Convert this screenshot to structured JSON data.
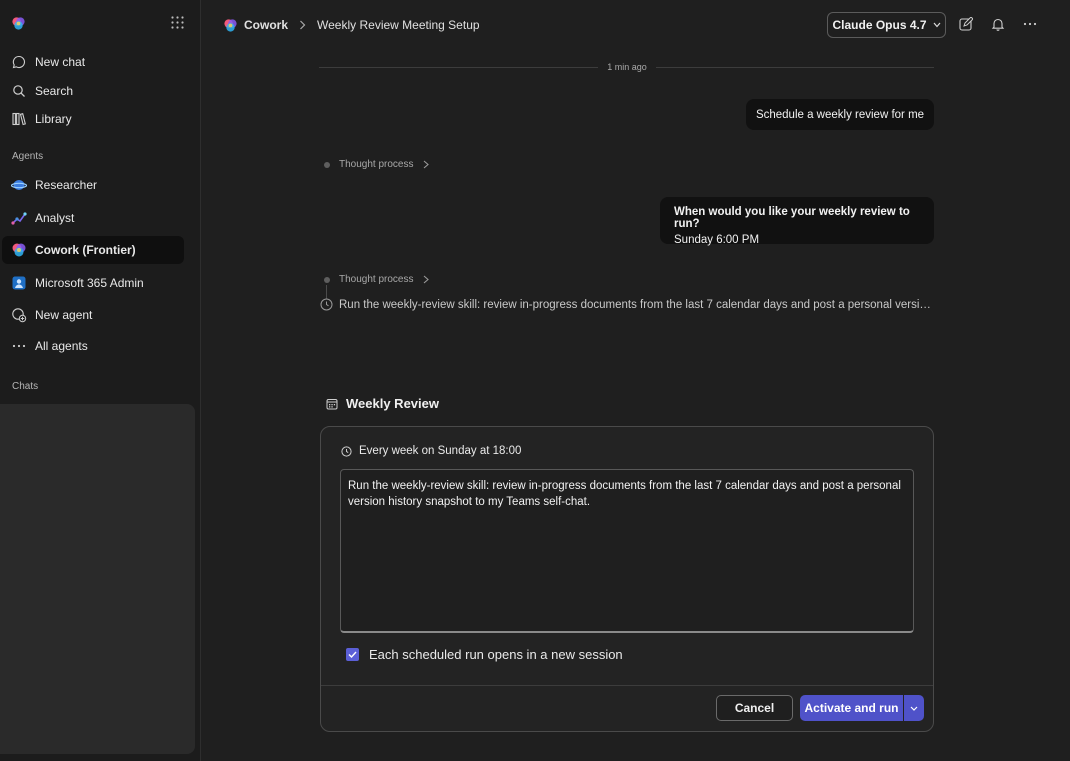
{
  "sidebar": {
    "items": [
      {
        "label": "New chat",
        "icon": "chat-bubble-icon"
      },
      {
        "label": "Search",
        "icon": "search-icon"
      },
      {
        "label": "Library",
        "icon": "library-icon"
      }
    ],
    "agents_heading": "Agents",
    "agents": [
      {
        "label": "Researcher",
        "icon": "researcher-icon"
      },
      {
        "label": "Analyst",
        "icon": "analyst-icon"
      },
      {
        "label": "Cowork (Frontier)",
        "icon": "cowork-icon",
        "active": true
      },
      {
        "label": "Microsoft 365 Admin",
        "icon": "m365-admin-icon"
      },
      {
        "label": "New agent",
        "icon": "new-agent-icon"
      },
      {
        "label": "All agents",
        "icon": "ellipsis-icon"
      }
    ],
    "chats_heading": "Chats"
  },
  "header": {
    "app": "Cowork",
    "title": "Weekly Review Meeting Setup",
    "model": "Claude Opus 4.7"
  },
  "chat": {
    "timestamp": "1 min ago",
    "user_message_1": "Schedule a weekly review for me",
    "thought_label": "Thought process",
    "bubble_2_question": "When would you like your weekly review to run?",
    "bubble_2_answer": "Sunday 6:00 PM",
    "task_text": "Run the weekly-review skill: review in-progress documents from the last 7 calendar days and post a personal version hi..."
  },
  "card": {
    "title": "Weekly Review",
    "schedule": "Every week on Sunday at 18:00",
    "prompt": "Run the weekly-review skill: review in-progress documents from the last 7 calendar days and post a personal version history snapshot to my Teams self-chat.",
    "checkbox_label": "Each scheduled run opens in a new session",
    "checkbox_checked": true,
    "cancel_label": "Cancel",
    "activate_label": "Activate and run"
  },
  "colors": {
    "accent": "#4f52c9",
    "background": "#1f1f1f",
    "sidebar": "#1c1c1c"
  }
}
